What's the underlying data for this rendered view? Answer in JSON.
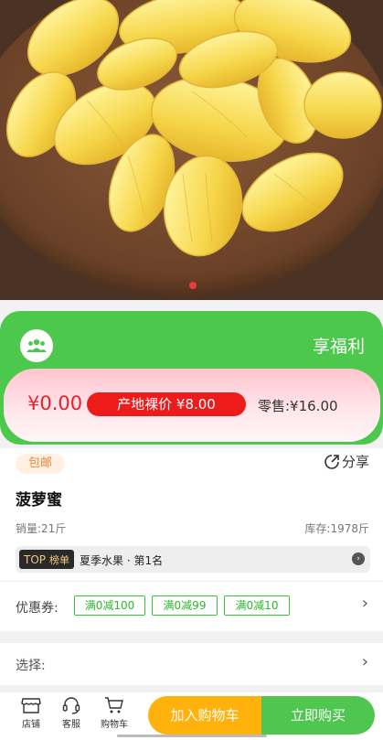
{
  "hero": {
    "image_alt": "jackfruit-on-wooden-plate"
  },
  "welfare": {
    "title": "享福利"
  },
  "price": {
    "now": "¥0.00",
    "origin": "产地裸价 ¥8.00",
    "retail": "零售:¥16.00"
  },
  "product": {
    "badge": "包邮",
    "share": "分享",
    "name": "菠萝蜜",
    "sold": "销量:21斤",
    "stock": "库存:1978斤"
  },
  "rank": {
    "top": "TOP",
    "board": "榜单",
    "text": "夏季水果 · 第1名"
  },
  "coupons": {
    "label": "优惠券:",
    "items": [
      "满0减100",
      "满0减99",
      "满0减10"
    ]
  },
  "select": {
    "label": "选择:"
  },
  "tabbar": {
    "store": "店铺",
    "service": "客服",
    "cart": "购物车",
    "add_to_cart": "加入购物车",
    "buy_now": "立即购买"
  },
  "colors": {
    "green": "#4cc84c",
    "red": "#ee1b1b",
    "orange": "#ffb20c"
  }
}
